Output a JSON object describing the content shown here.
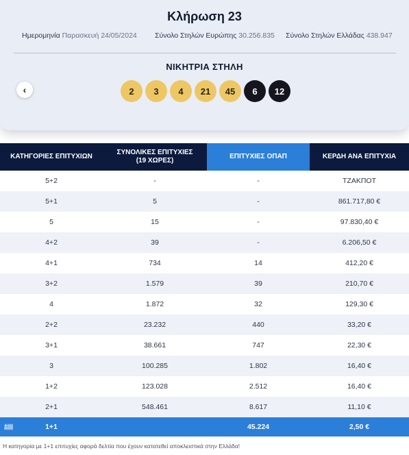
{
  "draw": {
    "title": "Κλήρωση 23",
    "date_label": "Ημερομηνία",
    "date_value": "Παρασκευή 24/05/2024",
    "europe_label": "Σύνολο Στηλών Ευρώπης",
    "europe_value": "30.256.835",
    "greece_label": "Σύνολο Στηλών Ελλάδας",
    "greece_value": "438.947",
    "winning_title": "ΝΙΚΗΤΡΙΑ ΣΤΗΛΗ",
    "prev_icon": "‹",
    "main_numbers": [
      "2",
      "3",
      "4",
      "21",
      "45"
    ],
    "star_numbers": [
      "6",
      "12"
    ]
  },
  "table": {
    "headers": {
      "category": "ΚΑΤΗΓΟΡΙΕΣ ΕΠΙΤΥΧΙΩΝ",
      "total_wins_line1": "ΣΥΝΟΛΙΚΕΣ ΕΠΙΤΥΧΙΕΣ",
      "total_wins_line2": "(19 ΧΩΡΕΣ)",
      "opap_wins": "ΕΠΙΤΥΧΙΕΣ ΟΠΑΠ",
      "prize": "ΚΕΡΔΗ ΑΝΑ ΕΠΙΤΥΧΙΑ"
    },
    "rows": [
      {
        "category": "5+2",
        "total": "-",
        "opap": "-",
        "prize": "ΤΖΑΚΠΟΤ"
      },
      {
        "category": "5+1",
        "total": "5",
        "opap": "-",
        "prize": "861.717,80 €"
      },
      {
        "category": "5",
        "total": "15",
        "opap": "-",
        "prize": "97.830,40 €"
      },
      {
        "category": "4+2",
        "total": "39",
        "opap": "-",
        "prize": "6.206,50 €"
      },
      {
        "category": "4+1",
        "total": "734",
        "opap": "14",
        "prize": "412,20 €"
      },
      {
        "category": "3+2",
        "total": "1.579",
        "opap": "39",
        "prize": "210,70 €"
      },
      {
        "category": "4",
        "total": "1.872",
        "opap": "32",
        "prize": "129,30 €"
      },
      {
        "category": "2+2",
        "total": "23.232",
        "opap": "440",
        "prize": "33,20 €"
      },
      {
        "category": "3+1",
        "total": "38.661",
        "opap": "747",
        "prize": "22,30 €"
      },
      {
        "category": "3",
        "total": "100.285",
        "opap": "1.802",
        "prize": "16,40 €"
      },
      {
        "category": "1+2",
        "total": "123.028",
        "opap": "2.512",
        "prize": "16,40 €"
      },
      {
        "category": "2+1",
        "total": "548.461",
        "opap": "8.617",
        "prize": "11,10 €"
      }
    ],
    "footer": {
      "category": "1+1",
      "total": "",
      "opap": "45.224",
      "prize": "2,50 €"
    },
    "flag_icon": "greek-flag-icon"
  },
  "note": "Η κατηγορία με 1+1 επιτυχίες αφορά δελτία που έχουν κατατεθεί αποκλειστικά στην Ελλάδα!"
}
